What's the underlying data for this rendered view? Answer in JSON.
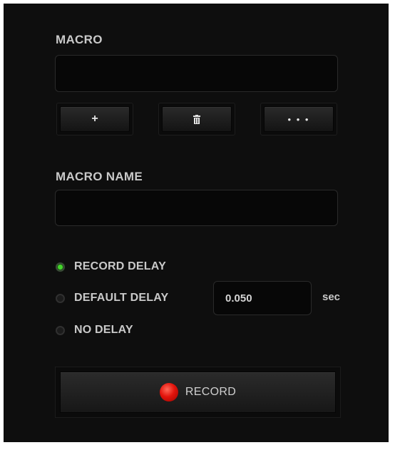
{
  "macro": {
    "title": "MACRO",
    "value": "",
    "buttons": {
      "add_label": "+",
      "delete_icon": "trash-icon",
      "more_label": "• • •"
    }
  },
  "macro_name": {
    "title": "MACRO NAME",
    "value": ""
  },
  "delay_options": {
    "selected": "record",
    "record_label": "RECORD DELAY",
    "default_label": "DEFAULT DELAY",
    "none_label": "NO DELAY",
    "default_value": "0.050",
    "unit": "sec"
  },
  "record": {
    "label": "RECORD",
    "icon": "record-dot-icon"
  },
  "colors": {
    "accent": "#44d62c",
    "record": "#e3140c",
    "panel": "#0e0e0e"
  }
}
